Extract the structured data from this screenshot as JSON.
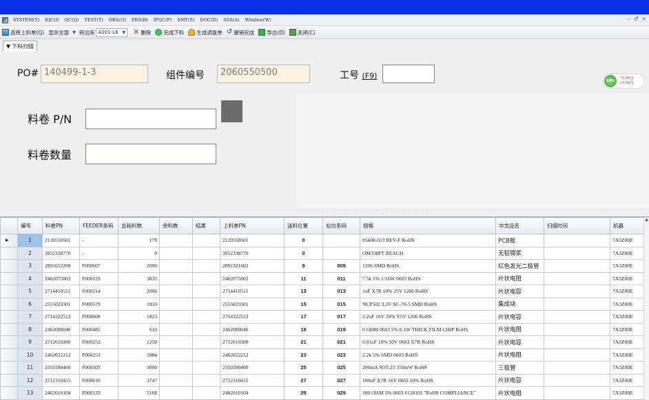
{
  "menu": [
    "SYSTEM(Y)",
    "IQC(I)",
    "QC(Q)",
    "TEST(T)",
    "OBA(O)",
    "FRS(B)",
    "IPQC(P)",
    "SMT(S)",
    "DOC(D)",
    "ASS(A)",
    "Window(W)"
  ],
  "window_controls": "– ♂ ×",
  "toolbar": {
    "select_list": "选择上料单(Q)",
    "show_all": "显示全部",
    "transfer_label": "转出库",
    "transfer_value": "A101-L6",
    "delete": "删除",
    "finish_feed": "完成下料",
    "gen_list": "生成调拨单",
    "undo_finish": "撤销完成",
    "export": "导出(D)",
    "close": "关闭(C)"
  },
  "tab": {
    "label": "下料扫描"
  },
  "form": {
    "po_label": "PO#",
    "po_value": "140499-1-3",
    "component_label": "组件编号",
    "component_value": "2060550500",
    "job_label": "工号",
    "job_shortcut": "(F9)",
    "job_value": "",
    "reel_pn_label": "料卷 P/N",
    "reel_pn_value": "",
    "reel_qty_label": "料卷数量",
    "reel_qty_value": ""
  },
  "network": {
    "percent": "59%",
    "up": "0.0K/S",
    "down": "0.0K/S"
  },
  "grid": {
    "headers": [
      "编号",
      "料卷PN",
      "FEEDER条码",
      "总耗料数",
      "余料数",
      "结果",
      "上料单PN",
      "送料位置",
      "站位条码",
      "规格",
      "中文品名",
      "扫描时间",
      "机器"
    ],
    "rows": [
      [
        "1",
        "2120550501",
        "-",
        "179",
        "",
        "",
        "2120550501",
        "0",
        "",
        "#5608-013 REV-F RoHS",
        "PCB板",
        "",
        "7A3Z00E"
      ],
      [
        "2",
        "3952338770",
        "-",
        "0",
        "",
        "",
        "3952338770",
        "0",
        "",
        "OM338PT REACH",
        "无铅锡浆",
        "",
        "7A3Z00E"
      ],
      [
        "3",
        "2891652200",
        "F000607",
        "2000",
        "",
        "",
        "2891321602",
        "9",
        "009",
        "1206 SMD RoHS",
        "红色发光二极管",
        "",
        "7A3Z00E"
      ],
      [
        "4",
        "2462075002",
        "F000129",
        "3835",
        "",
        "",
        "2462075002",
        "11",
        "011",
        "7.5k 1% 1/16W 0603 RoHS",
        "片状电阻",
        "",
        "7A3Z00E"
      ],
      [
        "5",
        "2714410511",
        "F000214",
        "2000",
        "",
        "",
        "2714410511",
        "13",
        "013",
        "1uF X7R 10% 25V 1206 RoHS",
        "片状电容",
        "",
        "7A3Z00E"
      ],
      [
        "6",
        "2555023301",
        "F000579",
        "1910",
        "",
        "",
        "2555023301",
        "15",
        "015",
        "NCP502 3.3V SC-70-5 SMD RoHS",
        "集成块",
        "",
        "7A3Z00E"
      ],
      [
        "7",
        "2714322512",
        "F000608",
        "1823",
        "",
        "",
        "2714322512",
        "17",
        "017",
        "2.2uF 16V 20% Y5V 1206 RoHS",
        "片状电容",
        "",
        "7A3Z00E"
      ],
      [
        "8",
        "2462000046",
        "F000485",
        "610",
        "",
        "",
        "2462000046",
        "19",
        "019",
        "0 OHM 0603 5% 0.1W THICK FILM CHIP RoHS",
        "片状电阻",
        "",
        "7A3Z00E"
      ],
      [
        "9",
        "2712610300",
        "F000252",
        "1259",
        "",
        "",
        "2712610300",
        "21",
        "021",
        "0.01uF 10% 50V 0603 X7R RoHS",
        "片状电容",
        "",
        "7A3Z00E"
      ],
      [
        "10",
        "2462022212",
        "F000253",
        "1884",
        "",
        "",
        "2462022212",
        "23",
        "023",
        "2.2k 5% SMD 0603 RoHS",
        "片状电阻",
        "",
        "7A3Z00E"
      ],
      [
        "11",
        "2350390400",
        "F000505",
        "3000",
        "",
        "",
        "2350390400",
        "25",
        "025",
        "200mA SOT-23 350mW RoHS",
        "三极管",
        "",
        "7A3Z00E"
      ],
      [
        "12",
        "2712310415",
        "F000610",
        "3747",
        "",
        "",
        "2712310415",
        "27",
        "027",
        "100nF X7R 16V 0603 10% RoHS",
        "片状电容",
        "",
        "7A3Z00E"
      ],
      [
        "13",
        "2462010104",
        "F000133",
        "5168",
        "",
        "",
        "2462010104",
        "29",
        "029",
        "100 OHM 5% 0603 #128101 \"RoHS COMPLIANCE\"",
        "片状电阻",
        "",
        "7A3Z00E"
      ]
    ]
  }
}
